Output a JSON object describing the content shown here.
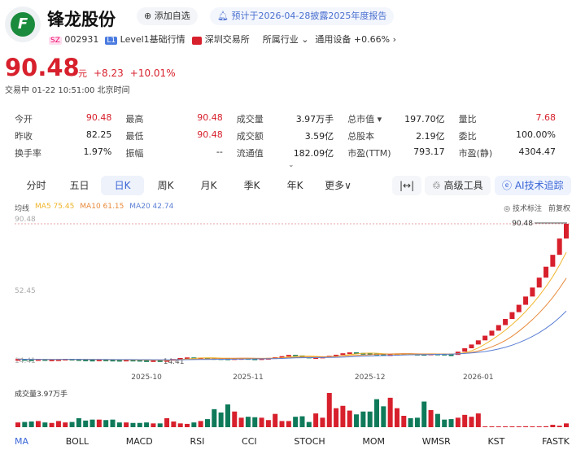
{
  "header": {
    "logo_text": "F",
    "name": "锋龙股份",
    "add_watch": "添加自选",
    "notice": "预计于2026-04-28披露2025年度报告",
    "market_tag": "SZ",
    "code": "002931",
    "level_tag": "L1",
    "level": "Level1基础行情",
    "exchange": "深圳交易所",
    "industry_label": "所属行业",
    "industry": "通用设备",
    "industry_change": "+0.66%"
  },
  "quote": {
    "price": "90.48",
    "unit": "元",
    "change": "+8.23",
    "change_pct": "+10.01%",
    "status": "交易中 01-22 10:51:00 北京时间"
  },
  "stats": [
    {
      "k": "今开",
      "v": "90.48",
      "red": true
    },
    {
      "k": "最高",
      "v": "90.48",
      "red": true
    },
    {
      "k": "成交量",
      "v": "3.97万手"
    },
    {
      "k": "总市值 ▾",
      "v": "197.70亿"
    },
    {
      "k": "量比",
      "v": "7.68",
      "red": true
    },
    {
      "k": "",
      "v": ""
    },
    {
      "k": "昨收",
      "v": "82.25"
    },
    {
      "k": "最低",
      "v": "90.48",
      "red": true
    },
    {
      "k": "成交额",
      "v": "3.59亿"
    },
    {
      "k": "总股本",
      "v": "2.19亿"
    },
    {
      "k": "委比",
      "v": "100.00%"
    },
    {
      "k": "",
      "v": ""
    },
    {
      "k": "换手率",
      "v": "1.97%"
    },
    {
      "k": "振幅",
      "v": "--"
    },
    {
      "k": "流通值",
      "v": "182.09亿"
    },
    {
      "k": "市盈(TTM)",
      "v": "793.17"
    },
    {
      "k": "市盈(静)",
      "v": "4304.47"
    },
    {
      "k": "",
      "v": ""
    }
  ],
  "tabs": [
    "分时",
    "五日",
    "日K",
    "周K",
    "月K",
    "季K",
    "年K",
    "更多∨"
  ],
  "tools": {
    "fit": "|↔|",
    "advanced": "高级工具",
    "ai": "AI技术追踪"
  },
  "ma": {
    "label": "均线",
    "ma5": "MA5 75.45",
    "ma10": "MA10 61.15",
    "ma20": "MA20 42.74"
  },
  "chart_tools": {
    "annotate": "◎ 技术标注",
    "adjust": "前复权"
  },
  "colors": {
    "up": "#d7202c",
    "down": "#0e7a5a",
    "ma5": "#f0b429",
    "ma10": "#e8893a",
    "ma20": "#5b7fd4"
  },
  "chart_data": {
    "type": "candlestick",
    "y_labels": [
      "90.48",
      "52.45",
      "14.41"
    ],
    "ylim": [
      14.41,
      90.48
    ],
    "max_label": "90.48",
    "min_label": "14.41",
    "x_ticks": [
      {
        "label": "2025-10",
        "index": 19
      },
      {
        "label": "2025-11",
        "index": 34
      },
      {
        "label": "2025-12",
        "index": 52
      },
      {
        "label": "2026-01",
        "index": 68
      }
    ],
    "close": [
      15.2,
      15.0,
      14.9,
      15.1,
      14.8,
      14.9,
      15.0,
      15.3,
      15.1,
      14.9,
      14.8,
      14.7,
      14.9,
      14.8,
      14.7,
      14.6,
      14.8,
      14.7,
      14.5,
      14.4,
      14.5,
      14.41,
      14.6,
      15.2,
      15.8,
      16.1,
      15.9,
      16.0,
      15.7,
      15.6,
      15.5,
      15.4,
      15.6,
      15.7,
      15.5,
      15.4,
      15.6,
      15.8,
      16.2,
      16.8,
      17.5,
      17.2,
      16.5,
      16.0,
      16.2,
      16.5,
      17.0,
      17.6,
      18.4,
      18.9,
      18.6,
      18.5,
      18.2,
      17.9,
      17.5,
      17.8,
      18.0,
      18.3,
      18.1,
      18.0,
      17.9,
      18.2,
      18.1,
      17.8,
      17.5,
      19.3,
      21.2,
      23.3,
      25.6,
      28.2,
      31.0,
      34.1,
      37.5,
      41.3,
      45.4,
      50.0,
      55.0,
      60.5,
      66.6,
      73.2,
      82.25,
      90.48
    ],
    "volume_label": "成交量3.97万手",
    "volume": [
      1.0,
      1.1,
      1.2,
      1.3,
      1.0,
      0.9,
      1.3,
      1.0,
      1.1,
      1.9,
      1.4,
      1.6,
      1.6,
      1.5,
      1.6,
      1.0,
      1.0,
      0.9,
      0.9,
      1.0,
      0.8,
      0.8,
      1.9,
      1.2,
      0.8,
      0.7,
      1.0,
      1.3,
      1.7,
      3.8,
      3.1,
      4.8,
      3.3,
      2.0,
      2.2,
      2.1,
      2.0,
      1.5,
      2.8,
      1.3,
      1.3,
      2.2,
      2.3,
      1.1,
      2.9,
      2.0,
      7.2,
      4.0,
      4.5,
      3.5,
      2.7,
      3.3,
      3.3,
      5.9,
      4.4,
      6.2,
      4.0,
      2.4,
      1.9,
      2.0,
      5.4,
      3.6,
      2.8,
      1.6,
      1.7,
      2.0,
      2.6,
      2.2,
      2.9,
      0.1,
      0.05,
      0.05,
      0.1,
      0.05,
      0.1,
      0.2,
      0.15,
      0.1,
      0.2,
      0.5,
      0.3,
      0.8
    ]
  },
  "indicators": [
    "MA",
    "BOLL",
    "MACD",
    "RSI",
    "CCI",
    "STOCH",
    "MOM",
    "WMSR",
    "KST",
    "FASTK"
  ]
}
